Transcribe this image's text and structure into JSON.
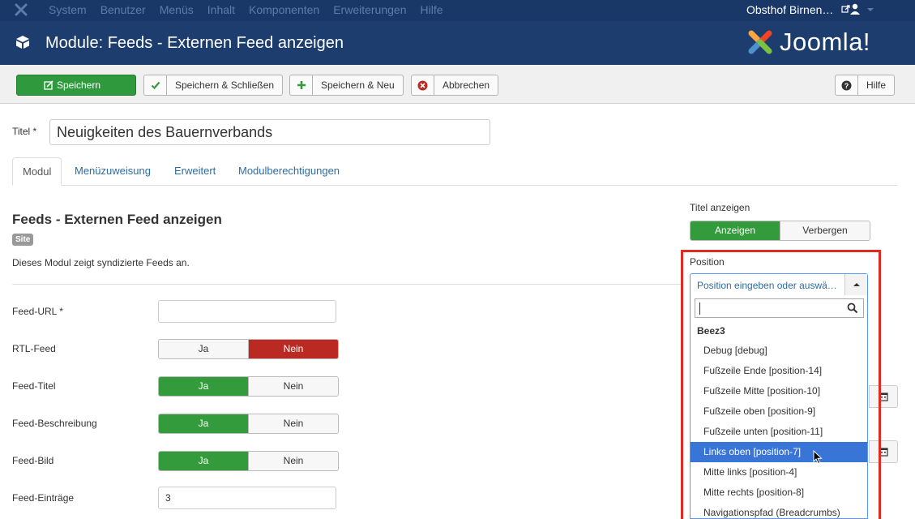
{
  "topnav": {
    "menu": [
      "System",
      "Benutzer",
      "Menüs",
      "Inhalt",
      "Komponenten",
      "Erweiterungen",
      "Hilfe"
    ],
    "site_name": "Obsthof Birnen…",
    "ext_icon": "external-link-icon",
    "user_icon": "user-icon"
  },
  "header": {
    "title": "Module: Feeds - Externen Feed anzeigen",
    "brand": "Joomla!"
  },
  "toolbar": {
    "save": "Speichern",
    "save_close": "Speichern & Schließen",
    "save_new": "Speichern & Neu",
    "cancel": "Abbrechen",
    "help": "Hilfe"
  },
  "form": {
    "title_label": "Titel *",
    "title_value": "Neuigkeiten des Bauernverbands",
    "tabs": [
      "Modul",
      "Menüzuweisung",
      "Erweitert",
      "Modulberechtigungen"
    ],
    "module_heading": "Feeds - Externen Feed anzeigen",
    "badge": "Site",
    "description": "Dieses Modul zeigt syndizierte Feeds an.",
    "fields": {
      "feed_url": {
        "label": "Feed-URL *",
        "value": ""
      },
      "rtl": {
        "label": "RTL-Feed",
        "yes": "Ja",
        "no": "Nein",
        "selected": "Nein"
      },
      "feed_title": {
        "label": "Feed-Titel",
        "yes": "Ja",
        "no": "Nein",
        "selected": "Ja"
      },
      "feed_desc": {
        "label": "Feed-Beschreibung",
        "yes": "Ja",
        "no": "Nein",
        "selected": "Ja"
      },
      "feed_image": {
        "label": "Feed-Bild",
        "yes": "Ja",
        "no": "Nein",
        "selected": "Ja"
      },
      "feed_items": {
        "label": "Feed-Einträge",
        "value": "3"
      }
    }
  },
  "right": {
    "show_title_label": "Titel anzeigen",
    "show": "Anzeigen",
    "hide": "Verbergen",
    "position_label": "Position",
    "position_placeholder": "Position eingeben oder auswählen",
    "dropdown_group": "Beez3",
    "dropdown_items": [
      "Debug [debug]",
      "Fußzeile Ende [position-14]",
      "Fußzeile Mitte [position-10]",
      "Fußzeile oben [position-9]",
      "Fußzeile unten [position-11]",
      "Links oben [position-7]",
      "Mitte links [position-4]",
      "Mitte rechts [position-8]",
      "Navigationspfad (Breadcrumbs)"
    ],
    "highlighted_item": "Links oben [position-7]"
  },
  "colors": {
    "nav_bg": "#1a3867",
    "header_bg": "#1c3d6e",
    "green": "#339b3c",
    "red": "#bb2a22",
    "highlight": "#3875d7",
    "annotation_red": "#e02b20"
  }
}
